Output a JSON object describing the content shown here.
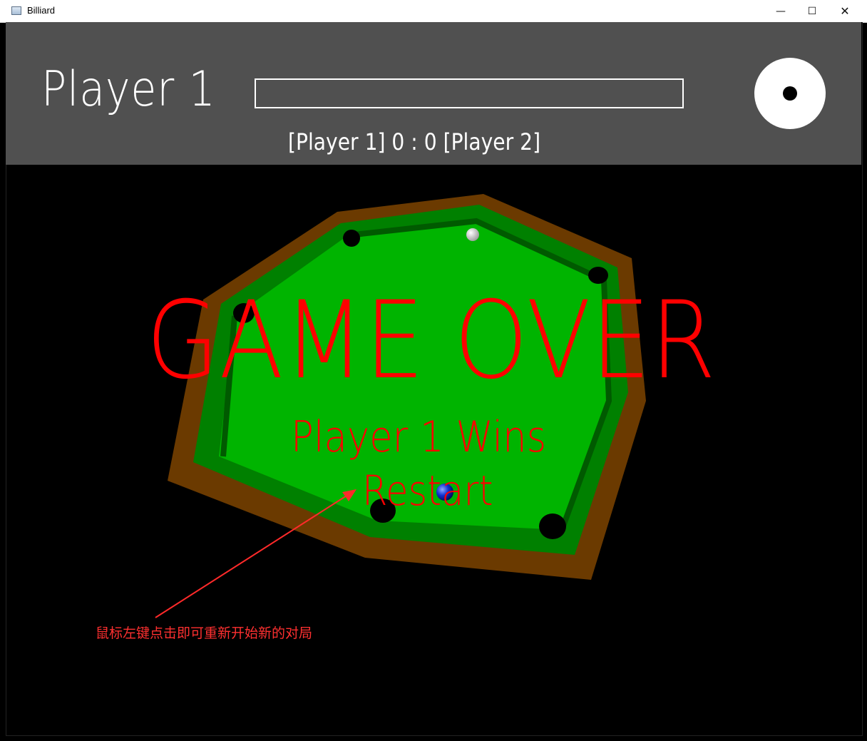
{
  "window": {
    "title": "Billiard",
    "minimize_glyph": "—",
    "maximize_glyph": "☐",
    "close_glyph": "✕"
  },
  "hud": {
    "current_player": "Player 1",
    "power_level": 0,
    "score": "[Player 1] 0 : 0 [Player 2]"
  },
  "overlay": {
    "game_over": "GAME OVER",
    "winner": "Player 1 Wins",
    "restart": "Restart"
  },
  "annotation": {
    "text": "鼠标左键点击即可重新开始新的对局"
  },
  "colors": {
    "hud_bg": "#505050",
    "felt": "#00b400",
    "cushion": "#008000",
    "rail": "#6b3a00",
    "overlay_text": "#ff0000",
    "annotation": "#ff3030"
  },
  "icons": {
    "app": "billiard-app-icon",
    "cue_indicator": "cue-ball-target-icon"
  }
}
